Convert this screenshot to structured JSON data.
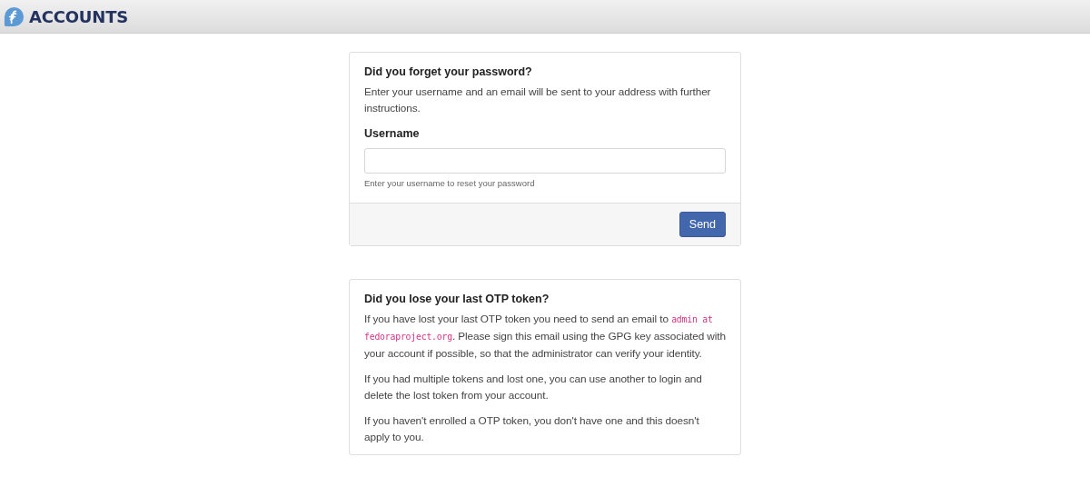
{
  "header": {
    "title": "ACCOUNTS"
  },
  "reset_card": {
    "title": "Did you forget your password?",
    "intro": "Enter your username and an email will be sent to your address with further instructions.",
    "field_label": "Username",
    "help": "Enter your username to reset your password",
    "button": "Send"
  },
  "otp_card": {
    "title": "Did you lose your last OTP token?",
    "paragraphs": [
      [
        {
          "kind": "text",
          "text": "If you have lost your last OTP token you need to send an email to "
        },
        {
          "kind": "code",
          "text": "admin at fedoraproject.org"
        },
        {
          "kind": "text",
          "text": ". Please sign this email using the GPG key associated with your account if possible, so that the administrator can verify your identity."
        }
      ],
      [
        {
          "kind": "text",
          "text": "If you had multiple tokens and lost one, you can use another to login and delete the lost token from your account."
        }
      ],
      [
        {
          "kind": "text",
          "text": "If you haven't enrolled a OTP token, you don't have one and this doesn't apply to you."
        }
      ]
    ]
  }
}
